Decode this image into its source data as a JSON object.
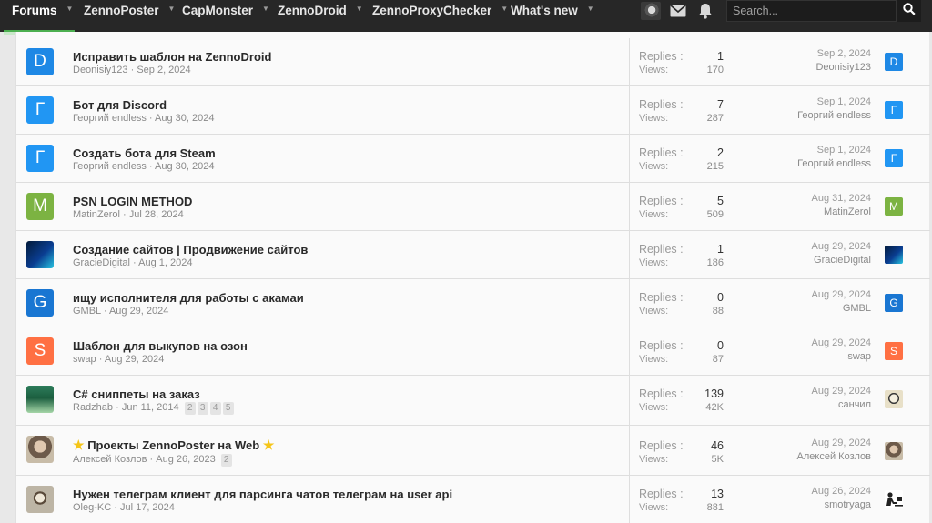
{
  "nav": {
    "items": [
      {
        "label": "Forums",
        "active": true
      },
      {
        "label": "ZennoPoster"
      },
      {
        "label": "CapMonster"
      },
      {
        "label": "ZennoDroid"
      },
      {
        "label": "ZennoProxyChecker"
      },
      {
        "label": "What's new"
      }
    ],
    "search_placeholder": "Search..."
  },
  "labels": {
    "replies": "Replies :",
    "views": "Views:"
  },
  "threads": [
    {
      "title": "Исправить шаблон на ZennoDroid",
      "author": "Deonisiy123",
      "date": "Sep 2, 2024",
      "replies": "1",
      "views": "170",
      "last_date": "Sep 2, 2024",
      "last_user": "Deonisiy123",
      "avatar_letter": "D",
      "avatar_color": "#1e88e5"
    },
    {
      "title": "Бот для Discord",
      "author": "Георгий endless",
      "date": "Aug 30, 2024",
      "replies": "7",
      "views": "287",
      "last_date": "Sep 1, 2024",
      "last_user": "Георгий endless",
      "avatar_letter": "Г",
      "avatar_color": "#2196f3"
    },
    {
      "title": "Создать бота для Steam",
      "author": "Георгий endless",
      "date": "Aug 30, 2024",
      "replies": "2",
      "views": "215",
      "last_date": "Sep 1, 2024",
      "last_user": "Георгий endless",
      "avatar_letter": "Г",
      "avatar_color": "#2196f3"
    },
    {
      "title": "PSN LOGIN METHOD",
      "author": "MatinZerol",
      "date": "Jul 28, 2024",
      "replies": "5",
      "views": "509",
      "last_date": "Aug 31, 2024",
      "last_user": "MatinZerol",
      "avatar_letter": "M",
      "avatar_color": "#7cb342"
    },
    {
      "title": "Создание сайтов | Продвижение сайтов",
      "author": "GracieDigital",
      "date": "Aug 1, 2024",
      "replies": "1",
      "views": "186",
      "last_date": "Aug 29, 2024",
      "last_user": "GracieDigital",
      "avatar_letter": "",
      "avatar_color": "#0d47a1"
    },
    {
      "title": "ищу исполнителя для работы с акамаи",
      "author": "GMBL",
      "date": "Aug 29, 2024",
      "replies": "0",
      "views": "88",
      "last_date": "Aug 29, 2024",
      "last_user": "GMBL",
      "avatar_letter": "G",
      "avatar_color": "#1976d2"
    },
    {
      "title": "Шаблон для выкупов на озон",
      "author": "swap",
      "date": "Aug 29, 2024",
      "replies": "0",
      "views": "87",
      "last_date": "Aug 29, 2024",
      "last_user": "swap",
      "avatar_letter": "S",
      "avatar_color": "#ff7043"
    },
    {
      "title": "C# сниппеты на заказ",
      "author": "Radzhab",
      "date": "Jun 11, 2014",
      "pages": [
        "2",
        "3",
        "4",
        "5"
      ],
      "replies": "139",
      "views": "42K",
      "last_date": "Aug 29, 2024",
      "last_user": "санчил",
      "avatar_letter": "",
      "avatar_color": "#2e7d5b"
    },
    {
      "title": "Проекты ZennoPoster на Web",
      "author": "Алексей Козлов",
      "date": "Aug 26, 2023",
      "pages": [
        "2"
      ],
      "replies": "46",
      "views": "5K",
      "last_date": "Aug 29, 2024",
      "last_user": "Алексей Козлов",
      "avatar_letter": "",
      "avatar_color": "#8d6e63",
      "stars": true
    },
    {
      "title": "Нужен телеграм клиент для парсинга чатов телеграм на user api",
      "author": "Oleg-KC",
      "date": "Jul 17, 2024",
      "replies": "13",
      "views": "881",
      "last_date": "Aug 26, 2024",
      "last_user": "smotryaga",
      "avatar_letter": "",
      "avatar_color": "#9e9e9e"
    }
  ]
}
